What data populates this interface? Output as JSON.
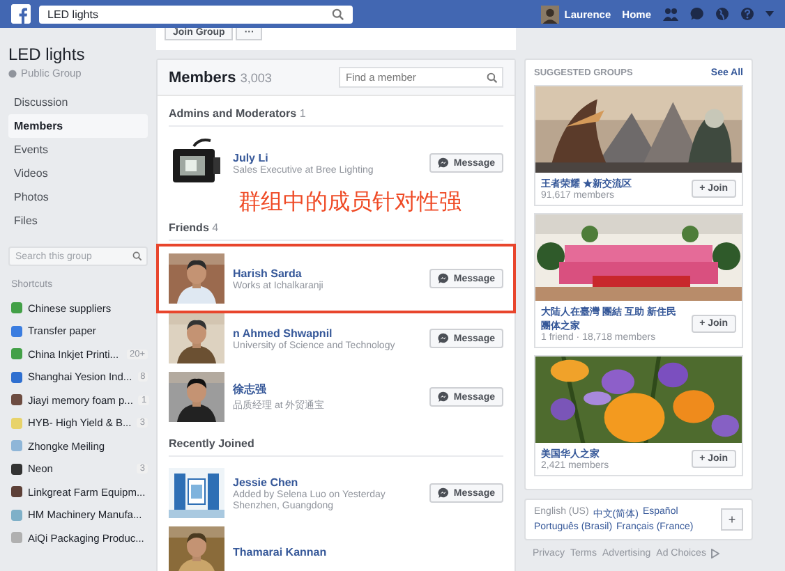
{
  "topbar": {
    "search": "LED lights",
    "user": "Laurence",
    "home": "Home"
  },
  "group": {
    "buttons": [
      "Join Group",
      "···"
    ],
    "name": "LED lights",
    "privacy": "Public Group"
  },
  "nav": [
    {
      "label": "Discussion",
      "selected": false
    },
    {
      "label": "Members",
      "selected": true
    },
    {
      "label": "Events",
      "selected": false
    },
    {
      "label": "Videos",
      "selected": false
    },
    {
      "label": "Photos",
      "selected": false
    },
    {
      "label": "Files",
      "selected": false
    }
  ],
  "group_search": {
    "placeholder": "Search this group"
  },
  "shortcuts": {
    "title": "Shortcuts",
    "items": [
      {
        "label": "Chinese suppliers",
        "color": "#43a047"
      },
      {
        "label": "Transfer paper",
        "color": "#3b7de0"
      },
      {
        "label": "China Inkjet Printi...",
        "color": "#43a047",
        "count": "20+"
      },
      {
        "label": "Shanghai Yesion Ind...",
        "color": "#2f6fd0",
        "count": "8"
      },
      {
        "label": "Jiayi memory foam p...",
        "color": "#6d4c41",
        "count": "1"
      },
      {
        "label": "HYB- High Yield & B...",
        "color": "#e8d36a",
        "count": "3"
      },
      {
        "label": "Zhongke Meiling",
        "color": "#8fb6d8"
      },
      {
        "label": "Neon",
        "color": "#333333",
        "count": "3"
      },
      {
        "label": "Linkgreat Farm Equipm...",
        "color": "#5d4037"
      },
      {
        "label": "HM Machinery Manufa...",
        "color": "#7fb0c8"
      },
      {
        "label": "AiQi Packaging Produc...",
        "color": "#b0b0b0"
      }
    ]
  },
  "members": {
    "title": "Members",
    "count": "3,003",
    "search_placeholder": "Find a member",
    "annotation": "群组中的成员针对性强",
    "sections": [
      {
        "title": "Admins and Moderators",
        "count": "1",
        "people": [
          {
            "name": "July Li",
            "lines": [
              "Sales Executive at Bree Lighting"
            ],
            "button": "Message",
            "highlighted": false
          }
        ]
      },
      {
        "title": "Friends",
        "count": "4",
        "people": [
          {
            "name": "Harish Sarda",
            "lines": [
              "Works at Ichalkaranji"
            ],
            "button": "Message",
            "highlighted": true
          },
          {
            "name": "n Ahmed Shwapnil",
            "lines": [
              "University of Science and Technology"
            ],
            "button": "Message",
            "highlighted": false
          },
          {
            "name": "徐志强",
            "lines": [
              "品质经理 at 外贸通宝"
            ],
            "button": "Message",
            "highlighted": false
          }
        ]
      },
      {
        "title": "Recently Joined",
        "people": [
          {
            "name": "Jessie Chen",
            "lines": [
              "Added by Selena Luo on Yesterday",
              "Shenzhen, Guangdong"
            ],
            "button": "Message",
            "highlighted": false
          },
          {
            "name": "Thamarai Kannan",
            "highlighted": false
          }
        ]
      }
    ]
  },
  "suggested": {
    "title": "SUGGESTED GROUPS",
    "see_all": "See All",
    "groups": [
      {
        "name": "王者荣耀 ★新交流区",
        "meta": "91,617 members",
        "button": "+ Join"
      },
      {
        "name": "大陆人在臺灣 團結 互助 新住民團体之家",
        "meta": "1 friend · 18,718 members",
        "button": "+ Join"
      },
      {
        "name": "美国华人之家",
        "meta": "2,421 members",
        "button": "+ Join"
      }
    ]
  },
  "languages": {
    "items": [
      {
        "label": "English (US)",
        "selected": true
      },
      {
        "label": "中文(简体)",
        "selected": false
      },
      {
        "label": "Español",
        "selected": false
      },
      {
        "label": "Português (Brasil)",
        "selected": false
      },
      {
        "label": "Français (France)",
        "selected": false
      }
    ],
    "add": "+"
  },
  "footer": [
    "Privacy",
    "Terms",
    "Advertising",
    "Ad Choices"
  ]
}
